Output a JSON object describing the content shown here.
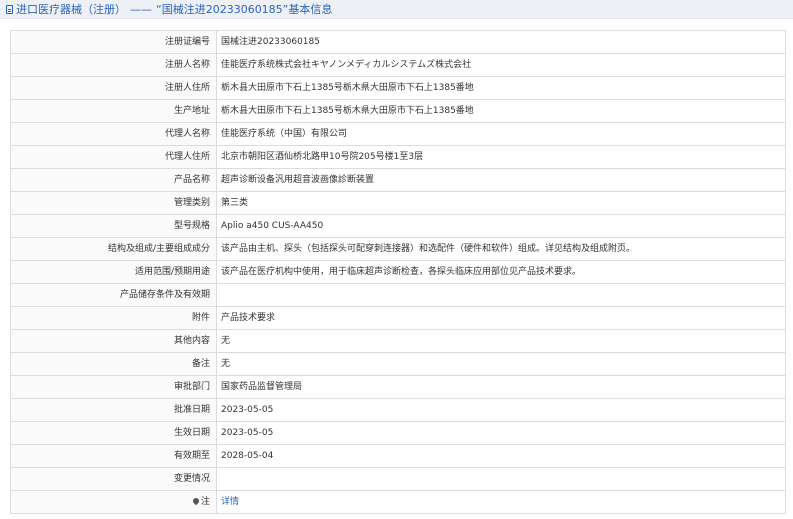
{
  "header": {
    "section": "进口医疗器械（注册）",
    "separator": "——",
    "title": "“国械注进20233060185”基本信息"
  },
  "rows": [
    {
      "label": "注册证编号",
      "value": "国械注进20233060185"
    },
    {
      "label": "注册人名称",
      "value": "佳能医疗系统株式会社キヤノンメディカルシステムズ株式会社"
    },
    {
      "label": "注册人住所",
      "value": "栃木县大田原市下石上1385号栃木県大田原市下石上1385番地"
    },
    {
      "label": "生产地址",
      "value": "栃木县大田原市下石上1385号栃木県大田原市下石上1385番地"
    },
    {
      "label": "代理人名称",
      "value": "佳能医疗系统（中国）有限公司"
    },
    {
      "label": "代理人住所",
      "value": "北京市朝阳区酒仙桥北路甲10号院205号楼1至3层"
    },
    {
      "label": "产品名称",
      "value": "超声诊断设备汎用超音波画像診断装置"
    },
    {
      "label": "管理类别",
      "value": "第三类"
    },
    {
      "label": "型号规格",
      "value": "Aplio a450 CUS-AA450"
    },
    {
      "label": "结构及组成/主要组成成分",
      "value": "该产品由主机、探头（包括探头可配穿刺连接器）和选配件（硬件和软件）组成。详见结构及组成附页。"
    },
    {
      "label": "适用范围/预期用途",
      "value": "该产品在医疗机构中使用，用于临床超声诊断检查，各探头临床应用部位见产品技术要求。"
    },
    {
      "label": "产品储存条件及有效期",
      "value": ""
    },
    {
      "label": "附件",
      "value": "产品技术要求"
    },
    {
      "label": "其他内容",
      "value": "无"
    },
    {
      "label": "备注",
      "value": "无"
    },
    {
      "label": "审批部门",
      "value": "国家药品监督管理局"
    },
    {
      "label": "批准日期",
      "value": "2023-05-05"
    },
    {
      "label": "生效日期",
      "value": "2023-05-05"
    },
    {
      "label": "有效期至",
      "value": "2028-05-04"
    },
    {
      "label": "变更情况",
      "value": ""
    }
  ],
  "note_row": {
    "label": "注",
    "link": "详情",
    "icon": "pin-icon"
  }
}
